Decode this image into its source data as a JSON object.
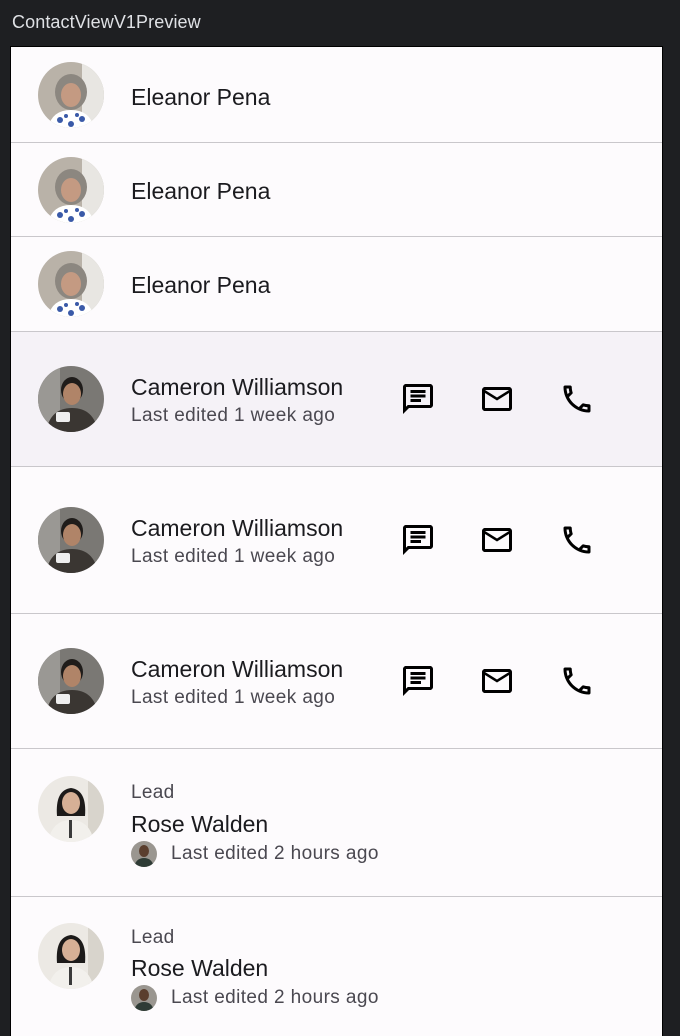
{
  "window": {
    "title": "ContactViewV1Preview"
  },
  "contacts_simple": [
    {
      "name": "Eleanor Pena",
      "avatar": "woman-gray-hair-avatar"
    },
    {
      "name": "Eleanor Pena",
      "avatar": "woman-gray-hair-avatar"
    },
    {
      "name": "Eleanor Pena",
      "avatar": "woman-gray-hair-avatar"
    }
  ],
  "contacts_actions": [
    {
      "name": "Cameron Williamson",
      "subtitle": "Last edited 1 week ago",
      "actions": [
        "message-icon",
        "email-icon",
        "phone-icon"
      ]
    },
    {
      "name": "Cameron Williamson",
      "subtitle": "Last edited 1 week ago",
      "actions": [
        "message-icon",
        "email-icon",
        "phone-icon"
      ]
    },
    {
      "name": "Cameron Williamson",
      "subtitle": "Last edited 1 week ago",
      "actions": [
        "message-icon",
        "email-icon",
        "phone-icon"
      ]
    }
  ],
  "contacts_lead": [
    {
      "overline": "Lead",
      "name": "Rose Walden",
      "subtitle": "Last edited 2 hours ago"
    },
    {
      "overline": "Lead",
      "name": "Rose Walden",
      "subtitle": "Last edited 2 hours ago"
    }
  ],
  "colors": {
    "surface": "#fdfbfd",
    "surface_variant": "#f5f2f7",
    "divider": "#c9c7cb",
    "text_primary": "#1b1b1f",
    "text_secondary": "#4a4850",
    "chrome": "#1e1f22"
  }
}
